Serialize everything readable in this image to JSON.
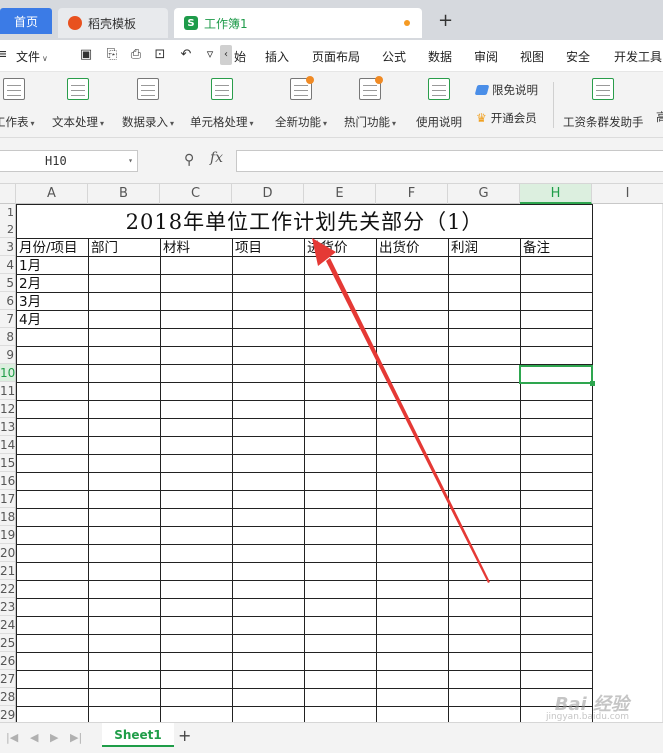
{
  "tabs": {
    "home": "首页",
    "template": "稻壳模板",
    "workbook": "工作簿1",
    "template_icon_letter": "",
    "workbook_icon_letter": "S",
    "new_tab": "+"
  },
  "menubar": {
    "file": "文件",
    "partial": "始",
    "items": [
      "插入",
      "页面布局",
      "公式",
      "数据",
      "审阅",
      "视图",
      "安全",
      "开发工具"
    ]
  },
  "ribbon": {
    "worksheet": "工作表",
    "text_process": "文本处理",
    "data_entry": "数据录入",
    "cell_process": "单元格处理",
    "new_features": "全新功能",
    "hot_features": "热门功能",
    "usage_guide": "使用说明",
    "disclaimer": "限免说明",
    "open_member": "开通会员",
    "payroll": "工资条群发助手",
    "overflow": "高"
  },
  "formula": {
    "name_box": "H10",
    "fx": "fx",
    "value": ""
  },
  "columns": [
    "A",
    "B",
    "C",
    "D",
    "E",
    "F",
    "G",
    "H",
    "I"
  ],
  "selected_column": "H",
  "rows": [
    "1",
    "2",
    "3",
    "4",
    "5",
    "6",
    "7",
    "8",
    "9",
    "10",
    "11",
    "12",
    "13",
    "14",
    "15",
    "16",
    "17",
    "18",
    "19",
    "20",
    "21",
    "22",
    "23",
    "24",
    "25",
    "26",
    "27",
    "28",
    "29"
  ],
  "selected_row": "10",
  "table": {
    "title": "2018年单位工作计划先关部分（1）",
    "headers": [
      "月份/项目",
      "部门",
      "材料",
      "项目",
      "进货价",
      "出货价",
      "利润",
      "备注"
    ],
    "months": [
      "1月",
      "2月",
      "3月",
      "4月"
    ]
  },
  "sheet_tabs": {
    "active": "Sheet1",
    "add": "+"
  },
  "watermark": {
    "brand": "Bai 经验",
    "sub": "jingyan.baidu.com"
  },
  "colors": {
    "accent_green": "#2ea64f",
    "tab_blue": "#3b7be6",
    "arrow_red": "#e53935"
  }
}
